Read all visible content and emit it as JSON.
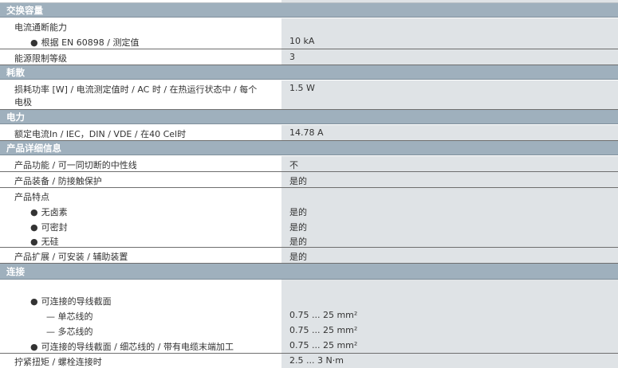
{
  "sections": {
    "switching": {
      "title": "交换容量",
      "rows": {
        "breaking_label": "电流通断能力",
        "en60898_label": "根据 EN 60898 / 测定值",
        "en60898_value": "10 kA",
        "energy_label": "能源限制等级",
        "energy_value": "3"
      }
    },
    "consumption": {
      "title": "耗散",
      "rows": {
        "loss_label_line1": "损耗功率 [W] / 电流测定值时 / AC 时 / 在热运行状态中 / 每个",
        "loss_label_line2": "电极",
        "loss_value": "1.5 W"
      }
    },
    "power": {
      "title": "电力",
      "rows": {
        "rated_label": "额定电流In / IEC，DIN / VDE / 在40 Cel时",
        "rated_value": "14.78 A"
      }
    },
    "product": {
      "title": "产品详细信息",
      "rows": {
        "function_label": "产品功能 / 可一同切断的中性线",
        "function_value": "不",
        "equip_label": "产品装备 / 防接触保护",
        "equip_value": "是的",
        "features_label": "产品特点",
        "halogen_label": "无卤素",
        "halogen_value": "是的",
        "sealable_label": "可密封",
        "sealable_value": "是的",
        "silicone_label": "无硅",
        "silicone_value": "是的",
        "extension_label": "产品扩展 / 可安装 / 辅助装置",
        "extension_value": "是的"
      }
    },
    "connection": {
      "title": "连接",
      "rows": {
        "cross_label": "可连接的导线截面",
        "single_label": "— 单芯线的",
        "single_value": "0.75 ... 25 mm²",
        "multi_label": "— 多芯线的",
        "multi_value": "0.75 ... 25 mm²",
        "fine_label": "可连接的导线截面 / 细芯线的 / 带有电缆末端加工",
        "fine_value": "0.75 ... 25 mm²",
        "torque_label": "拧紧扭矩 / 螺栓连接时",
        "torque_value": "2.5 ... 3 N·m"
      }
    }
  },
  "bullet_symbol": "●"
}
